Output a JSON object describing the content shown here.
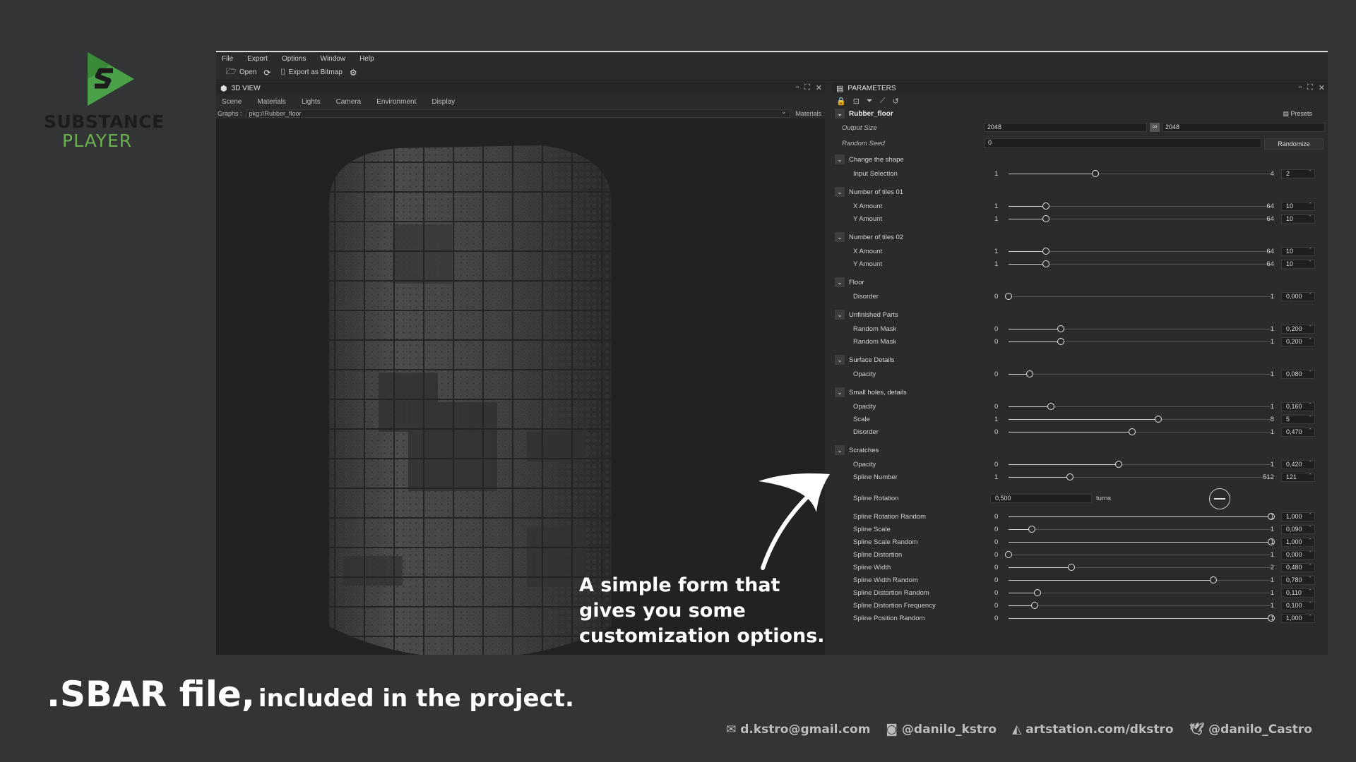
{
  "logo": {
    "line1": "SUBSTANCE",
    "line2": "PLAYER",
    "brand_color": "#6ab04c"
  },
  "menu": [
    "File",
    "Export",
    "Options",
    "Window",
    "Help"
  ],
  "toolbar": {
    "open": "Open",
    "export": "Export as Bitmap"
  },
  "view3d": {
    "title": "3D VIEW",
    "tabs": [
      "Scene",
      "Materials",
      "Lights",
      "Camera",
      "Environment",
      "Display"
    ],
    "graphs_label": "Graphs :",
    "graph_value": "pkg://Rubber_floor",
    "materials": "Materials"
  },
  "params": {
    "title": "PARAMETERS",
    "graph_name": "Rubber_floor",
    "presets": "Presets",
    "output_size_label": "Output Size",
    "output_w": "2048",
    "output_h": "2048",
    "random_seed_label": "Random Seed",
    "random_seed": "0",
    "randomize": "Randomize",
    "spline_rotation_label": "Spline Rotation",
    "spline_rotation_value": "0,500",
    "turns": "turns",
    "groups": [
      {
        "name": "Change the shape",
        "rows": [
          {
            "label": "Input Selection",
            "min": "1",
            "max": "4",
            "value": "2",
            "frac": 0.33
          }
        ]
      },
      {
        "name": "Number of tiles 01",
        "rows": [
          {
            "label": "X Amount",
            "min": "1",
            "max": "64",
            "value": "10",
            "frac": 0.143
          },
          {
            "label": "Y Amount",
            "min": "1",
            "max": "64",
            "value": "10",
            "frac": 0.143
          }
        ]
      },
      {
        "name": "Number of tiles 02",
        "rows": [
          {
            "label": "X Amount",
            "min": "1",
            "max": "64",
            "value": "10",
            "frac": 0.143
          },
          {
            "label": "Y Amount",
            "min": "1",
            "max": "64",
            "value": "10",
            "frac": 0.143
          }
        ]
      },
      {
        "name": "Floor",
        "rows": [
          {
            "label": "Disorder",
            "min": "0",
            "max": "1",
            "value": "0,000",
            "frac": 0.0
          }
        ]
      },
      {
        "name": "Unfinished Parts",
        "rows": [
          {
            "label": "Random Mask",
            "min": "0",
            "max": "1",
            "value": "0,200",
            "frac": 0.2
          },
          {
            "label": "Random Mask",
            "min": "0",
            "max": "1",
            "value": "0,200",
            "frac": 0.2
          }
        ]
      },
      {
        "name": "Surface Details",
        "rows": [
          {
            "label": "Opacity",
            "min": "0",
            "max": "1",
            "value": "0,080",
            "frac": 0.08
          }
        ]
      },
      {
        "name": "Small holes, details",
        "rows": [
          {
            "label": "Opacity",
            "min": "0",
            "max": "1",
            "value": "0,160",
            "frac": 0.16
          },
          {
            "label": "Scale",
            "min": "1",
            "max": "8",
            "value": "5",
            "frac": 0.57
          },
          {
            "label": "Disorder",
            "min": "0",
            "max": "1",
            "value": "0,470",
            "frac": 0.47
          }
        ]
      },
      {
        "name": "Scratches",
        "rows": [
          {
            "label": "Opacity",
            "min": "0",
            "max": "1",
            "value": "0,420",
            "frac": 0.42
          },
          {
            "label": "Spline Number",
            "min": "1",
            "max": "512",
            "value": "121",
            "frac": 0.235
          }
        ]
      }
    ],
    "scratch_rows": [
      {
        "label": "Spline Rotation Random",
        "min": "0",
        "max": "1",
        "value": "1,000",
        "frac": 1.0
      },
      {
        "label": "Spline Scale",
        "min": "0",
        "max": "1",
        "value": "0,090",
        "frac": 0.09
      },
      {
        "label": "Spline Scale Random",
        "min": "0",
        "max": "1",
        "value": "1,000",
        "frac": 1.0
      },
      {
        "label": "Spline Distortion",
        "min": "0",
        "max": "1",
        "value": "0,000",
        "frac": 0.0
      },
      {
        "label": "Spline Width",
        "min": "0",
        "max": "2",
        "value": "0,480",
        "frac": 0.24
      },
      {
        "label": "Spline Width Random",
        "min": "0",
        "max": "1",
        "value": "0,780",
        "frac": 0.78
      },
      {
        "label": "Spline Distortion Random",
        "min": "0",
        "max": "1",
        "value": "0,110",
        "frac": 0.11
      },
      {
        "label": "Spline Distortion Frequency",
        "min": "0",
        "max": "1",
        "value": "0,100",
        "frac": 0.1
      },
      {
        "label": "Spline Position Random",
        "min": "0",
        "max": "1",
        "value": "1,000",
        "frac": 1.0
      }
    ]
  },
  "callout": "A simple form that gives you some customization options.",
  "caption": {
    "big": ".SBAR file,",
    "small": "included in the project."
  },
  "footer": {
    "email": "d.kstro@gmail.com",
    "instagram": "@danilo_kstro",
    "artstation": "artstation.com/dkstro",
    "twitter": "@danilo_Castro"
  }
}
